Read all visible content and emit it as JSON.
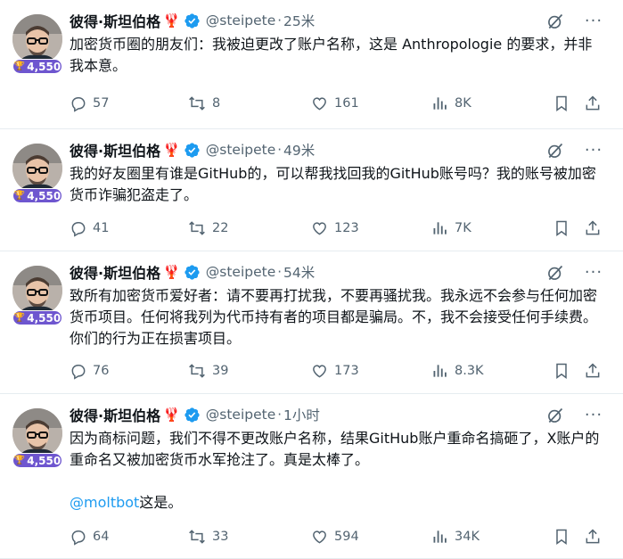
{
  "tweets": [
    {
      "author": "彼得·斯坦伯格",
      "emoji": "🦞",
      "handle": "@steipete",
      "dot": "·",
      "time": "25米",
      "badge_count": "4,550",
      "text": "加密货币圈的朋友们：我被迫更改了账户名称，这是 Anthropologie 的要求，并非我本意。",
      "mention": "",
      "mention_suffix": "",
      "replies": "57",
      "reposts": "8",
      "likes": "161",
      "views": "8K"
    },
    {
      "author": "彼得·斯坦伯格",
      "emoji": "🦞",
      "handle": "@steipete",
      "dot": "·",
      "time": "49米",
      "badge_count": "4,550",
      "text": "我的好友圈里有谁是GitHub的，可以帮我找回我的GitHub账号吗？我的账号被加密货币诈骗犯盗走了。",
      "mention": "",
      "mention_suffix": "",
      "replies": "41",
      "reposts": "22",
      "likes": "123",
      "views": "7K"
    },
    {
      "author": "彼得·斯坦伯格",
      "emoji": "🦞",
      "handle": "@steipete",
      "dot": "·",
      "time": "54米",
      "badge_count": "4,550",
      "text": "致所有加密货币爱好者：请不要再打扰我，不要再骚扰我。我永远不会参与任何加密货币项目。任何将我列为代币持有者的项目都是骗局。不，我不会接受任何手续费。你们的行为正在损害项目。",
      "mention": "",
      "mention_suffix": "",
      "replies": "76",
      "reposts": "39",
      "likes": "173",
      "views": "8.3K"
    },
    {
      "author": "彼得·斯坦伯格",
      "emoji": "🦞",
      "handle": "@steipete",
      "dot": "·",
      "time": "1小时",
      "badge_count": "4,550",
      "text": "因为商标问题，我们不得不更改账户名称，结果GitHub账户重命名搞砸了，X账户的重命名又被加密货币水军抢注了。真是太棒了。",
      "mention": "@moltbot",
      "mention_suffix": "这是。",
      "replies": "64",
      "reposts": "33",
      "likes": "594",
      "views": "34K"
    }
  ],
  "colors": {
    "verified": "#1d9bf0",
    "badge": "#6e56cf",
    "muted": "#536471",
    "link": "#1d9bf0"
  },
  "icons": [
    "grok-icon",
    "more-icon",
    "reply-icon",
    "repost-icon",
    "like-icon",
    "views-icon",
    "bookmark-icon",
    "share-icon",
    "verified-icon",
    "trophy-icon"
  ]
}
